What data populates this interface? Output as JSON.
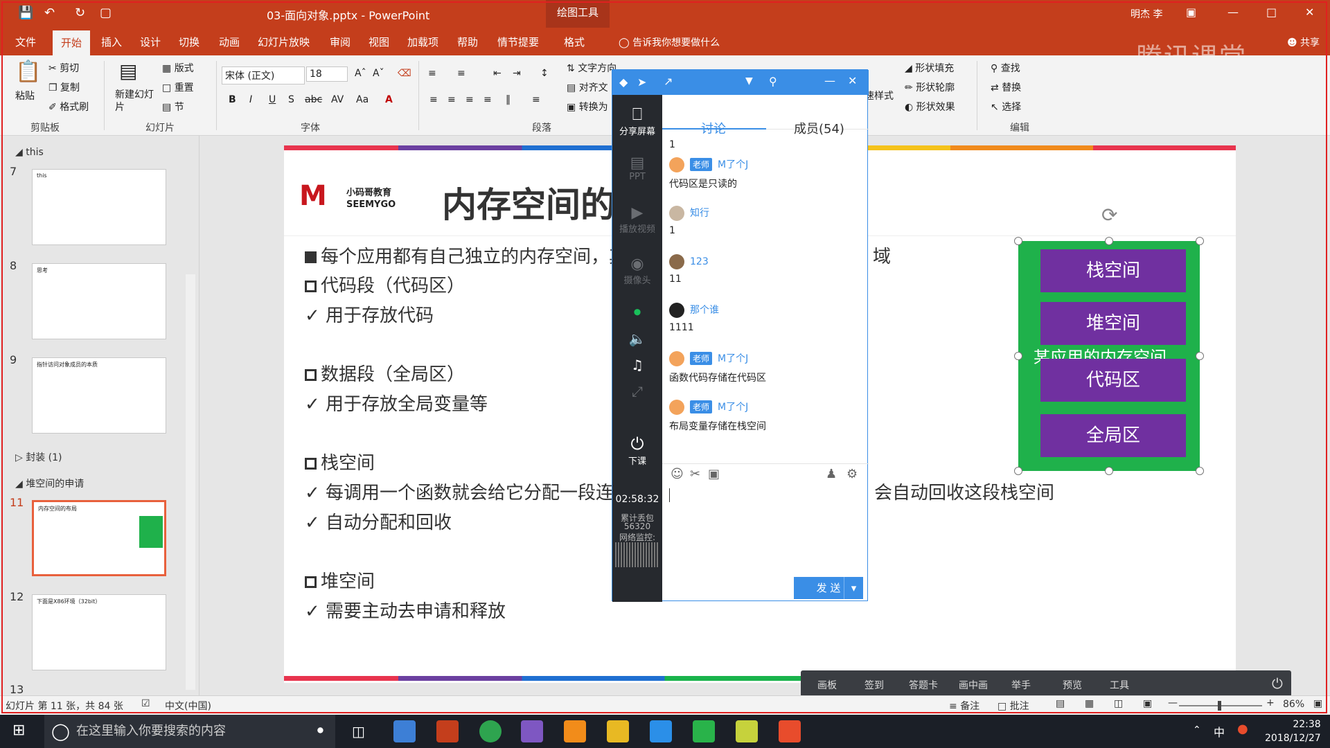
{
  "window": {
    "title": "03-面向对象.pptx - PowerPoint",
    "context_tab": "绘图工具",
    "user": "明杰 李"
  },
  "ribbon_tabs": [
    "文件",
    "开始",
    "插入",
    "设计",
    "切换",
    "动画",
    "幻灯片放映",
    "审阅",
    "视图",
    "加载项",
    "帮助",
    "情节提要",
    "格式"
  ],
  "tell_me": "告诉我你想要做什么",
  "share": "共享",
  "watermark": "腾讯课堂",
  "ribbon": {
    "paste": "粘贴",
    "cut": "剪切",
    "copy": "复制",
    "format_painter": "格式刷",
    "clipboard": "剪贴板",
    "new_slide": "新建幻灯片",
    "layout": "版式",
    "reset": "重置",
    "section": "节",
    "slides": "幻灯片",
    "font_name": "宋体 (正文)",
    "font_size": "18",
    "font": "字体",
    "text_direction": "文字方向",
    "align_text": "对齐文",
    "convert": "转换为",
    "paragraph": "段落",
    "quick_styles": "速样式",
    "shape_fill": "形状填充",
    "shape_outline": "形状轮廓",
    "shape_effects": "形状效果",
    "find": "查找",
    "replace": "替换",
    "select": "选择",
    "editing": "编辑"
  },
  "thumbs": {
    "sections": [
      "this",
      "封装 (1)",
      "堆空间的申请"
    ],
    "slides": [
      {
        "num": "7",
        "title": "this"
      },
      {
        "num": "8",
        "title": "思考"
      },
      {
        "num": "9",
        "title": "指针访问对象成员的本质"
      },
      {
        "num": "11",
        "title": "内存空间的布局"
      },
      {
        "num": "12",
        "title": "下面是X86环境（32bit）"
      },
      {
        "num": "13",
        "title": ""
      }
    ]
  },
  "slide": {
    "logo_cn": "小码哥教育",
    "logo_en": "SEEMYGO",
    "title": "内存空间的",
    "lines": [
      {
        "mark": "filled",
        "text": "每个应用都有自己独立的内存空间，其",
        "tail": "域"
      },
      {
        "mark": "box",
        "text": "代码段（代码区）"
      },
      {
        "mark": "check",
        "text": "✓ 用于存放代码"
      },
      {
        "mark": "box",
        "text": "数据段（全局区）"
      },
      {
        "mark": "check",
        "text": "✓ 用于存放全局变量等"
      },
      {
        "mark": "box",
        "text": "栈空间"
      },
      {
        "mark": "check",
        "text": "✓ 每调用一个函数就会给它分配一段连续",
        "tail": "会自动回收这段栈空间"
      },
      {
        "mark": "check",
        "text": "✓ 自动分配和回收"
      },
      {
        "mark": "box",
        "text": "堆空间"
      },
      {
        "mark": "check",
        "text": "✓ 需要主动去申请和释放"
      }
    ],
    "diagram": {
      "stack": "栈空间",
      "heap": "堆空间",
      "caption": "某应用的内存空间",
      "code": "代码区",
      "global": "全局区"
    }
  },
  "chat": {
    "tabs": {
      "discussion": "讨论",
      "members": "成员(54)"
    },
    "side": {
      "share_screen": "分享屏幕",
      "ppt": "PPT",
      "play_video": "播放视频",
      "camera": "摄像头",
      "end_class": "下课",
      "timer": "02:58:32",
      "packet_label": "累计丢包",
      "packet_count": "56320",
      "net_label": "网络监控:"
    },
    "messages": [
      {
        "name": "",
        "teacher": false,
        "text": "1"
      },
      {
        "name": "M了个J",
        "teacher": true,
        "text": "代码区是只读的"
      },
      {
        "name": "知行",
        "teacher": false,
        "text": "1"
      },
      {
        "name": "123",
        "teacher": false,
        "text": "11"
      },
      {
        "name": "那个谁",
        "teacher": false,
        "text": "1111"
      },
      {
        "name": "M了个J",
        "teacher": true,
        "text": "函数代码存储在代码区"
      },
      {
        "name": "M了个J",
        "teacher": true,
        "text": "布局变量存储在栈空间"
      }
    ],
    "teacher_badge": "老师",
    "send": "发 送"
  },
  "classbar": [
    "画板",
    "签到",
    "答题卡",
    "画中画",
    "举手",
    "预览",
    "工具"
  ],
  "status": {
    "slide_info": "幻灯片 第 11 张，共 84 张",
    "language": "中文(中国)",
    "notes": "备注",
    "comments": "批注",
    "zoom": "86%"
  },
  "taskbar": {
    "search": "在这里输入你要搜索的内容",
    "time": "22:38",
    "date": "2018/12/27",
    "ime": "中"
  },
  "colors": {
    "accent": "#c43e1c",
    "chat_blue": "#3a8ee6",
    "diagram_green": "#1fb14b",
    "diagram_purple": "#7030a0"
  }
}
